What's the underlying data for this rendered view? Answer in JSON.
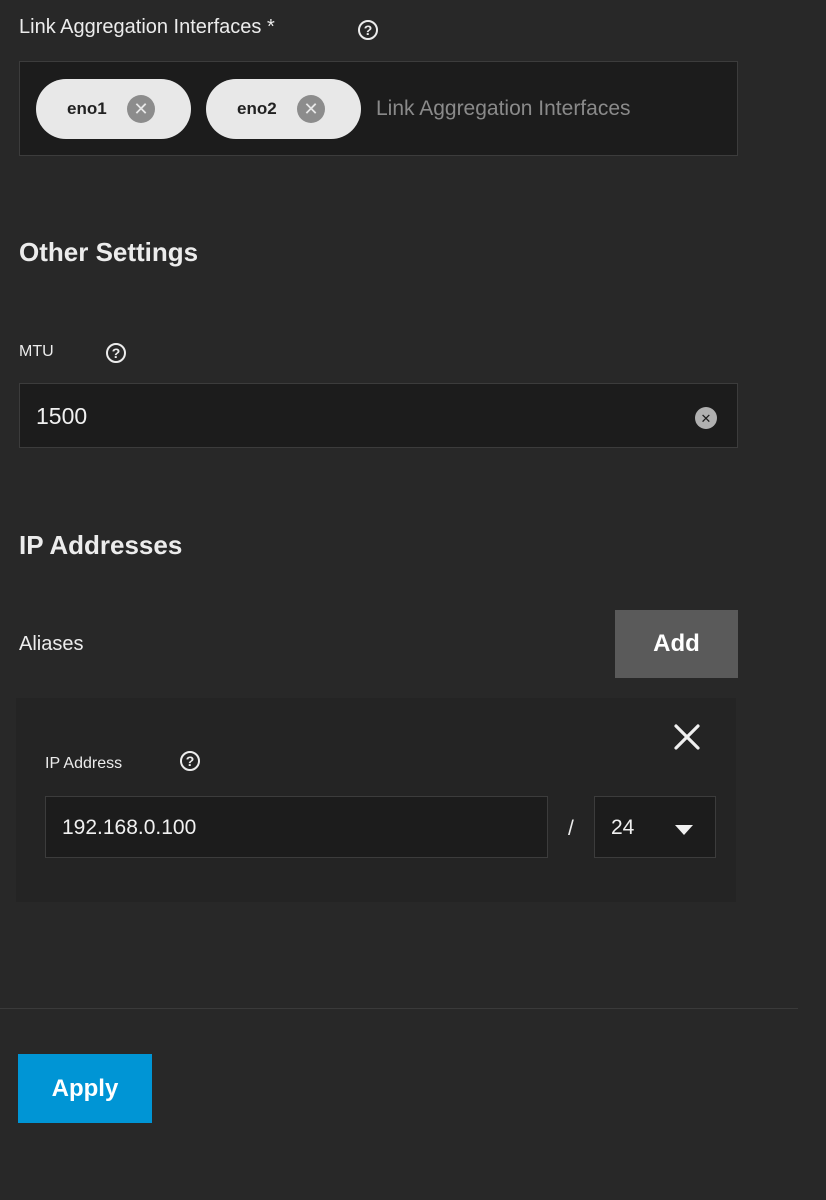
{
  "link_aggregation": {
    "label": "Link Aggregation Interfaces *",
    "chips": [
      {
        "label": "eno1"
      },
      {
        "label": "eno2"
      }
    ],
    "placeholder": "Link Aggregation Interfaces"
  },
  "other_settings": {
    "title": "Other Settings",
    "mtu": {
      "label": "MTU",
      "value": "1500"
    }
  },
  "ip_addresses": {
    "title": "IP Addresses",
    "aliases_label": "Aliases",
    "add_label": "Add",
    "alias": {
      "ip_label": "IP Address",
      "ip_value": "192.168.0.100",
      "separator": "/",
      "netmask": "24"
    }
  },
  "footer": {
    "apply_label": "Apply"
  },
  "colors": {
    "background": "#282828",
    "input_bg": "#1c1c1c",
    "chip_bg": "#e8e8e8",
    "add_button": "#5a5a5a",
    "apply_button": "#0095d5"
  },
  "icons": {
    "help": "help-circle-icon",
    "chip_remove": "close-circle-icon",
    "clear": "clear-icon",
    "remove_alias": "close-icon",
    "dropdown": "caret-down-icon"
  }
}
